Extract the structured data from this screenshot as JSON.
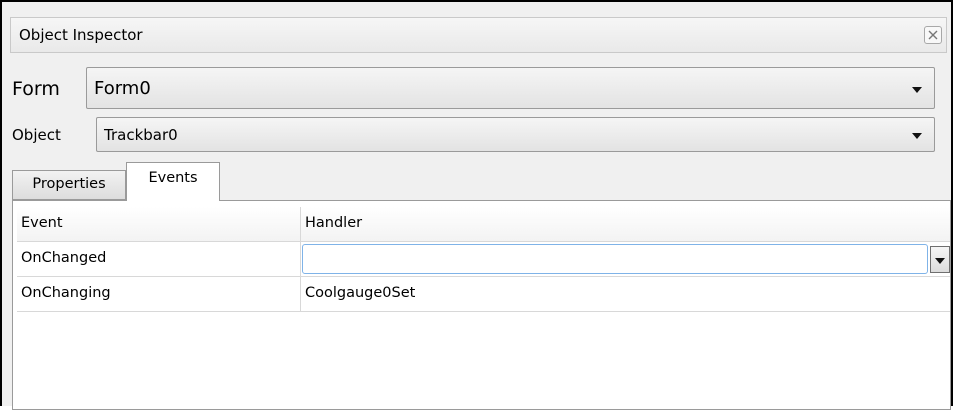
{
  "window": {
    "title": "Object Inspector",
    "close_icon": "close-icon"
  },
  "form_selector": {
    "label": "Form",
    "value": "Form0"
  },
  "object_selector": {
    "label": "Object",
    "value": "Trackbar0"
  },
  "tabs": [
    {
      "label": "Properties",
      "active": false
    },
    {
      "label": "Events",
      "active": true
    }
  ],
  "events_grid": {
    "columns": [
      "Event",
      "Handler"
    ],
    "rows": [
      {
        "event": "OnChanged",
        "handler": ""
      },
      {
        "event": "OnChanging",
        "handler": "Coolgauge0Set"
      }
    ]
  },
  "colors": {
    "editor_focus_border": "#7fb3e8",
    "panel_background": "#f0f0f0"
  }
}
